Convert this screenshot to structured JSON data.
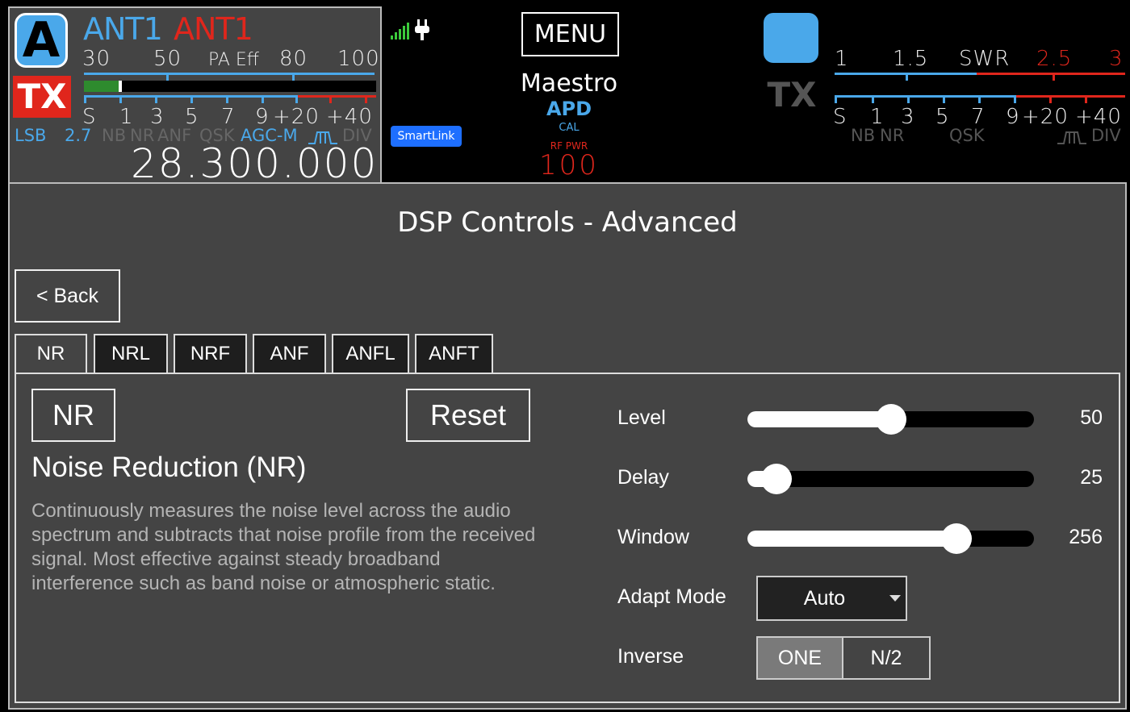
{
  "sliceA": {
    "letter": "A",
    "tx": "TX",
    "ant_rx": "ANT1",
    "ant_tx": "ANT1",
    "pa_scale": [
      "30",
      "50",
      "PA Eff",
      "80",
      "100"
    ],
    "s_scale": [
      "S",
      "1",
      "3",
      "5",
      "7",
      "9",
      "+20",
      "+40"
    ],
    "meter_level": 0.12,
    "mode": "LSB",
    "bandwidth": "2.7",
    "flags": [
      {
        "label": "NB",
        "active": false
      },
      {
        "label": "NR",
        "active": false
      },
      {
        "label": "ANF",
        "active": false
      },
      {
        "label": "QSK",
        "active": false
      },
      {
        "label": "AGC-M",
        "active": true
      }
    ],
    "filter_icon": "filter-shape-icon",
    "div": "DIV",
    "frequency": "28.300.000"
  },
  "center": {
    "signal_icon": "signal-bars-icon",
    "power_icon": "plug-icon",
    "smartlink": "SmartLink",
    "menu": "MENU",
    "device": "Maestro",
    "apd": "APD",
    "cal": "CAL",
    "rf_pwr_label": "RF PWR",
    "rf_pwr": "100"
  },
  "sliceB": {
    "tx": "TX",
    "swr_scale": [
      "1",
      "1.5",
      "SWR",
      "2.5",
      "3"
    ],
    "s_scale": [
      "S",
      "1",
      "3",
      "5",
      "7",
      "9",
      "+20",
      "+40"
    ],
    "flags": [
      "NB",
      "NR",
      "QSK"
    ],
    "filter_icon": "filter-shape-icon",
    "div": "DIV"
  },
  "panel": {
    "title": "DSP Controls - Advanced",
    "back": "< Back",
    "tabs": [
      {
        "label": "NR",
        "active": true
      },
      {
        "label": "NRL",
        "active": false
      },
      {
        "label": "NRF",
        "active": false
      },
      {
        "label": "ANF",
        "active": false
      },
      {
        "label": "ANFL",
        "active": false
      },
      {
        "label": "ANFT",
        "active": false
      }
    ],
    "toggle": "NR",
    "reset": "Reset",
    "feature_title": "Noise Reduction (NR)",
    "feature_desc": "Continuously measures the noise level across the audio spectrum and subtracts that noise profile from the received signal. Most effective against steady broadband interference such as band noise or atmospheric static.",
    "controls": {
      "level": {
        "label": "Level",
        "value": "50",
        "fraction": 0.5
      },
      "delay": {
        "label": "Delay",
        "value": "25",
        "fraction": 0.1
      },
      "window": {
        "label": "Window",
        "value": "256",
        "fraction": 0.73
      },
      "adapt_mode": {
        "label": "Adapt Mode",
        "value": "Auto"
      },
      "inverse": {
        "label": "Inverse",
        "options": [
          "ONE",
          "N/2"
        ],
        "selected": 0
      }
    }
  },
  "colors": {
    "accent_blue": "#4aa8ea",
    "tx_red": "#e0261c",
    "panel_bg": "#444444",
    "meter_green": "#2e8b2e"
  }
}
